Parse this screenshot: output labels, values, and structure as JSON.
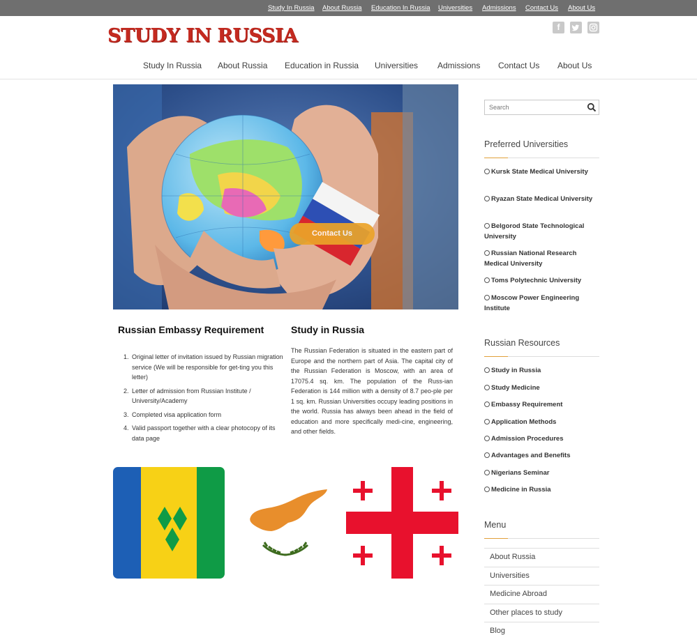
{
  "topbar": {
    "links": [
      "Study In Russia",
      "About Russia",
      "Education In Russia",
      "Universities",
      "Admissions",
      "Contact Us",
      "About Us"
    ]
  },
  "header": {
    "logo": "STUDY IN RUSSIA",
    "social": [
      "facebook-icon",
      "twitter-icon",
      "instagram-icon"
    ],
    "nav": [
      "Study In Russia",
      "About Russia",
      "Education in Russia",
      "Universities",
      "Admissions",
      "Contact Us",
      "About Us"
    ]
  },
  "hero": {
    "button_label": "Contact Us"
  },
  "embassy": {
    "title": "Russian Embassy Requirement",
    "items": [
      "Original letter of invitation issued by Russian migration service (We will be responsible for get-ting you this letter)",
      "Letter of admission from Russian Institute / University/Academy",
      "Completed visa application form",
      "Valid passport together with a clear photocopy of its data page"
    ]
  },
  "study": {
    "title": "Study in Russia",
    "text": "The Russian Federation is situated in the eastern part of Europe and the northern part of Asia. The capital city of the Russian Federation is Moscow, with an area of 17075.4 sq. km. The population of the Russ-ian Federation is 144 million with a density of 8.7 peo-ple per 1 sq. km. Russian Universities occupy leading positions in the world. Russia has always been ahead in the field of education and more specifically medi-cine, engineering, and other fields."
  },
  "sidebar": {
    "search_placeholder": "Search",
    "preferred": {
      "title": "Preferred Universities",
      "items": [
        "Kursk State Medical University",
        "Ryazan State Medical University",
        "Belgorod State Technological University",
        "Russian National Research Medical University",
        "Toms Polytechnic University",
        "Moscow Power Engineering Institute"
      ]
    },
    "resources": {
      "title": "Russian Resources",
      "items": [
        "Study in Russia",
        "Study Medicine",
        "Embassy Requirement",
        "Application Methods",
        "Admission Procedures",
        "Advantages and Benefits",
        "Nigerians Seminar",
        "Medicine in Russia"
      ]
    },
    "menu": {
      "title": "Menu",
      "items": [
        "About Russia",
        "Universities",
        "Medicine Abroad",
        "Other places to study",
        "Blog"
      ]
    }
  },
  "colors": {
    "topbar": "#6f6f6f",
    "logo": "#c42a20",
    "accent": "#e0a03a",
    "button": "#eba329"
  }
}
